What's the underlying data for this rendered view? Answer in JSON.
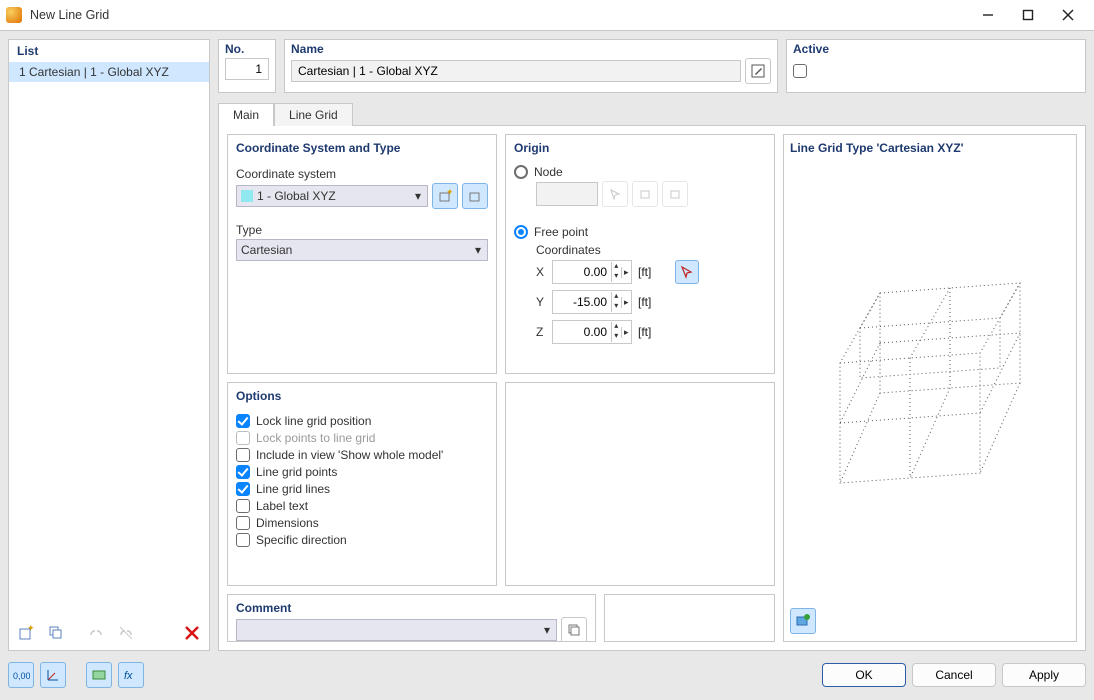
{
  "window": {
    "title": "New Line Grid"
  },
  "list": {
    "header": "List",
    "items": [
      {
        "id": "1",
        "label": "1   Cartesian | 1 - Global XYZ"
      }
    ]
  },
  "header": {
    "no_label": "No.",
    "no_value": "1",
    "name_label": "Name",
    "name_value": "Cartesian | 1 - Global XYZ",
    "active_label": "Active",
    "active_checked": false
  },
  "tabs": {
    "main": "Main",
    "line_grid": "Line Grid",
    "active": "main"
  },
  "coord_sys": {
    "title": "Coordinate System and Type",
    "cs_label": "Coordinate system",
    "cs_value": "1 - Global XYZ",
    "type_label": "Type",
    "type_value": "Cartesian"
  },
  "origin": {
    "title": "Origin",
    "node_label": "Node",
    "freepoint_label": "Free point",
    "mode": "free_point",
    "coordinates_label": "Coordinates",
    "axes": [
      "X",
      "Y",
      "Z"
    ],
    "values": {
      "X": "0.00",
      "Y": "-15.00",
      "Z": "0.00"
    },
    "unit": "[ft]"
  },
  "options": {
    "title": "Options",
    "items": [
      {
        "key": "lock_pos",
        "label": "Lock line grid position",
        "checked": true,
        "disabled": false
      },
      {
        "key": "lock_pts",
        "label": "Lock points to line grid",
        "checked": false,
        "disabled": true
      },
      {
        "key": "include",
        "label": "Include in view 'Show whole model'",
        "checked": false,
        "disabled": false
      },
      {
        "key": "lg_points",
        "label": "Line grid points",
        "checked": true,
        "disabled": false
      },
      {
        "key": "lg_lines",
        "label": "Line grid lines",
        "checked": true,
        "disabled": false
      },
      {
        "key": "label",
        "label": "Label text",
        "checked": false,
        "disabled": false
      },
      {
        "key": "dims",
        "label": "Dimensions",
        "checked": false,
        "disabled": false
      },
      {
        "key": "specdir",
        "label": "Specific direction",
        "checked": false,
        "disabled": false
      }
    ]
  },
  "comment": {
    "title": "Comment",
    "value": ""
  },
  "preview": {
    "title": "Line Grid Type 'Cartesian XYZ'"
  },
  "buttons": {
    "ok": "OK",
    "cancel": "Cancel",
    "apply": "Apply"
  }
}
